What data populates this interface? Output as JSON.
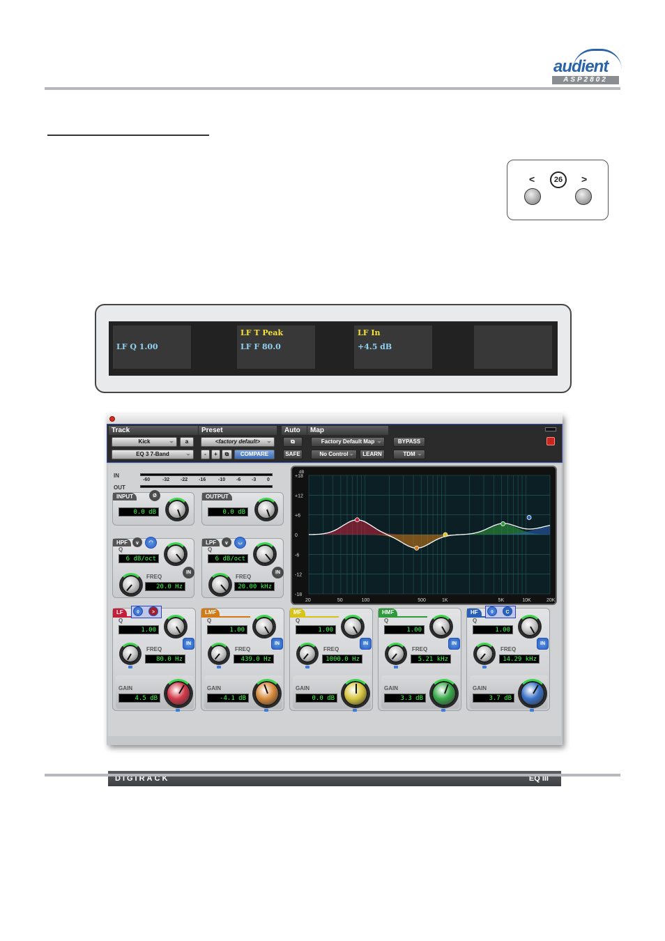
{
  "header": {
    "brand": "audient",
    "model": "ASP2802"
  },
  "nav": {
    "prev": "<",
    "next": ">",
    "page": "26"
  },
  "displays": [
    {
      "line1": "",
      "line2": "LF Q 1.00"
    },
    {
      "line1": "LF T Peak",
      "line2": "LF F 80.0"
    },
    {
      "line1": "LF In",
      "line2": "+4.5 dB"
    },
    {
      "line1": "",
      "line2": ""
    }
  ],
  "plugin": {
    "header": {
      "track_caption": "Track",
      "preset_caption": "Preset",
      "auto_caption": "Auto",
      "map_caption": "Map",
      "track_name": "Kick",
      "track_channel": "a",
      "plugin_name": "EQ 3 7-Band",
      "preset_name": "<factory default>",
      "minus": "-",
      "plus": "+",
      "compare": "COMPARE",
      "safe": "SAFE",
      "map_name": "Factory Default Map",
      "control": "No Control",
      "learn": "LEARN",
      "bypass": "BYPASS",
      "format": "TDM"
    },
    "meters": {
      "in_label": "IN",
      "out_label": "OUT",
      "scale": [
        "-60",
        "-32",
        "-22",
        "-16",
        "-10",
        "-6",
        "-3",
        "0"
      ]
    },
    "input": {
      "label": "INPUT",
      "value": "0.0 dB",
      "phase": "Ø"
    },
    "output": {
      "label": "OUTPUT",
      "value": "0.0 dB"
    },
    "hpf": {
      "label": "HPF",
      "q_label": "Q",
      "q": "6 dB/oct",
      "freq_label": "FREQ",
      "freq": "20.0 Hz",
      "in": "IN"
    },
    "lpf": {
      "label": "LPF",
      "q_label": "Q",
      "q": "6 dB/oct",
      "freq_label": "FREQ",
      "freq": "20.00 kHz",
      "in": "IN"
    },
    "bands": [
      {
        "label": "LF",
        "color": "#c2203a",
        "q": "1.00",
        "freq": "80.0 Hz",
        "gain": "4.5 dB",
        "knob": "#d23848"
      },
      {
        "label": "LMF",
        "color": "#d27a18",
        "q": "1.00",
        "freq": "439.0 Hz",
        "gain": "-4.1 dB",
        "knob": "#d88a3a"
      },
      {
        "label": "MF",
        "color": "#d8c418",
        "q": "1.00",
        "freq": "1000.0 Hz",
        "gain": "0.0 dB",
        "knob": "#d8c640"
      },
      {
        "label": "HMF",
        "color": "#2f9a3a",
        "q": "1.00",
        "freq": "5.21 kHz",
        "gain": "3.3 dB",
        "knob": "#3aa84a"
      },
      {
        "label": "HF",
        "color": "#2a5fb8",
        "q": "1.00",
        "freq": "14.29 kHz",
        "gain": "3.7 dB",
        "knob": "#3a72c8"
      }
    ],
    "band_labels": {
      "q": "Q",
      "freq": "FREQ",
      "gain": "GAIN",
      "in": "IN"
    },
    "graph": {
      "db_label": "dB",
      "y_ticks": [
        "+18",
        "+12",
        "+6",
        "0",
        "-6",
        "-12",
        "-18"
      ],
      "x_ticks": [
        "20",
        "50",
        "100",
        "500",
        "1K",
        "5K",
        "10K",
        "20K"
      ],
      "gains": [
        4.5,
        -4.1,
        0.0,
        3.3,
        3.7
      ]
    },
    "footer": {
      "brand": "DIGIRACK",
      "product": "EQ III"
    }
  }
}
